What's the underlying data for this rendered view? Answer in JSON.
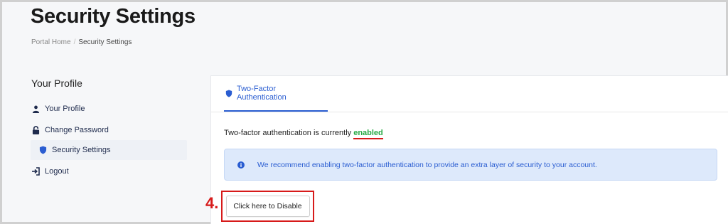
{
  "page": {
    "title": "Security Settings"
  },
  "breadcrumb": {
    "home": "Portal Home",
    "separator": "/",
    "current": "Security Settings"
  },
  "sidebar": {
    "title": "Your Profile",
    "items": [
      {
        "label": "Your Profile",
        "icon": "user-icon"
      },
      {
        "label": "Change Password",
        "icon": "lock-icon"
      },
      {
        "label": "Security Settings",
        "icon": "shield-icon",
        "active": true
      },
      {
        "label": "Logout",
        "icon": "logout-icon"
      }
    ]
  },
  "panel": {
    "tab_label": "Two-Factor Authentication",
    "status_prefix": "Two-factor authentication is currently",
    "status_value": "enabled",
    "alert_text": "We recommend enabling two-factor authentication to provide an extra layer of security to your account.",
    "disable_button_label": "Click here to Disable"
  },
  "annotation": {
    "step_label": "4."
  },
  "colors": {
    "accent": "#2a5dd1",
    "status_enabled": "#27a844",
    "annotation_red": "#d71a1a",
    "alert_bg": "#dde9fb"
  }
}
